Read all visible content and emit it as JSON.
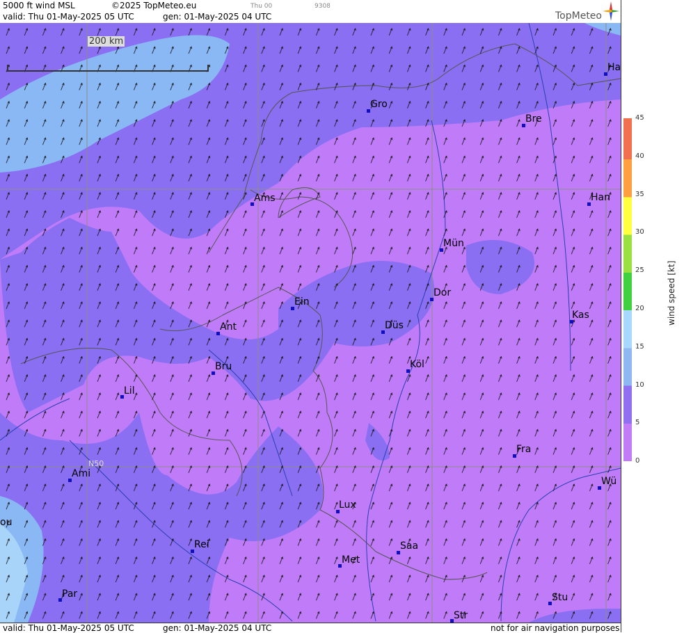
{
  "header": {
    "product": "5000 ft wind MSL",
    "copyright": "©2025 TopMeteo.eu",
    "valid": "valid:  Thu  01-May-2025  05 UTC",
    "gen": "gen: 01-May-2025 04 UTC",
    "tag1": "Thu 00",
    "tag2": "9308",
    "logo": "TopMeteo"
  },
  "footer": {
    "valid": "valid:  Thu  01-May-2025  05 UTC",
    "gen": "gen: 01-May-2025 04 UTC",
    "disclaimer": "not for air navigation purposes"
  },
  "map": {
    "scale_label": "200 km",
    "lat_label": "N50",
    "cities": [
      "Gro",
      "Bre",
      "Ha",
      "Ams",
      "Han",
      "Mün",
      "Ein",
      "Dor",
      "Kas",
      "Ant",
      "Düs",
      "Köl",
      "Bru",
      "Lil",
      "Fra",
      "Ami",
      "Wü",
      "Lux",
      "ou",
      "Rei",
      "Saa",
      "Met",
      "Par",
      "Stu",
      "Str"
    ]
  },
  "legend": {
    "unit": "wind  speed  [kt]",
    "ticks": [
      "45",
      "40",
      "35",
      "30",
      "25",
      "20",
      "15",
      "10",
      "5",
      "0"
    ],
    "colors": [
      "#c27cf7",
      "#9070f0",
      "#8fb8f2",
      "#a8d8ff",
      "#40d040",
      "#99e040",
      "#ffff40",
      "#ffa040",
      "#f07050"
    ]
  }
}
